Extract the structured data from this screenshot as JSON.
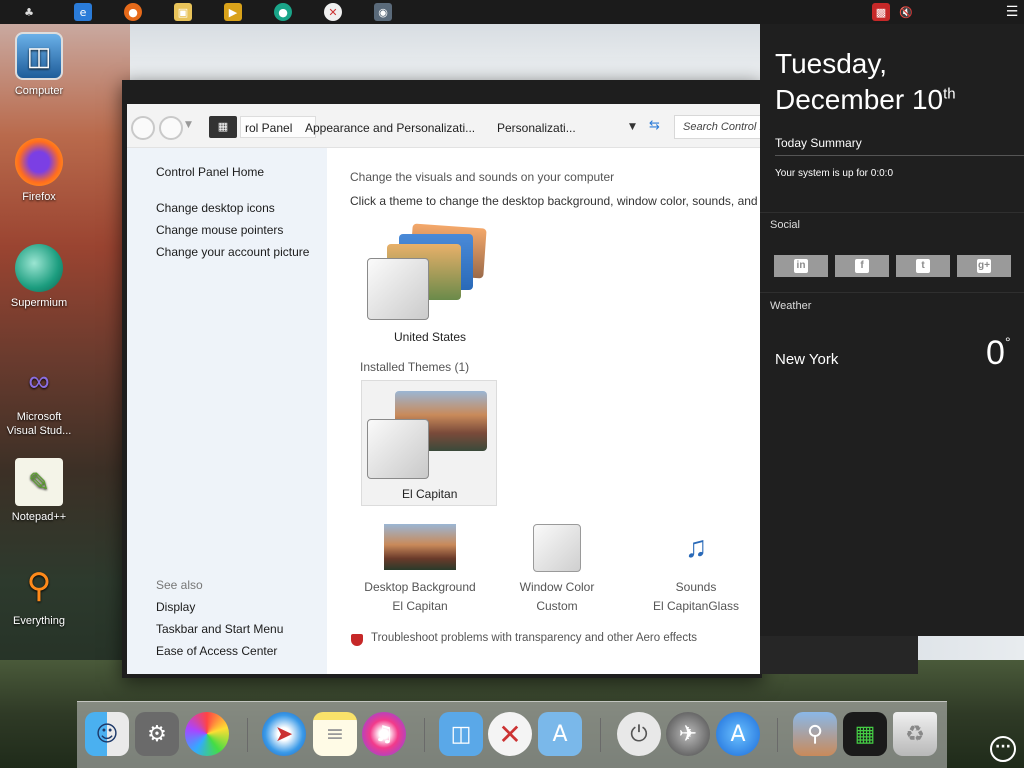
{
  "desktop": {
    "icons": [
      {
        "label": "Computer"
      },
      {
        "label": "Firefox"
      },
      {
        "label": "Supermium"
      },
      {
        "label": "Microsoft Visual Stud..."
      },
      {
        "label": "Notepad++"
      },
      {
        "label": "Everything"
      }
    ]
  },
  "window": {
    "breadcrumb": [
      "rol Panel",
      "Appearance and Personalizati...",
      "Personalizati..."
    ],
    "search_placeholder": "Search Control P",
    "left_nav": {
      "home": "Control Panel Home",
      "links": [
        "Change desktop icons",
        "Change mouse pointers",
        "Change your account picture"
      ],
      "see_also_label": "See also",
      "see_also": [
        "Display",
        "Taskbar and Start Menu",
        "Ease of Access Center"
      ]
    },
    "main": {
      "heading": "Change the visuals and sounds on your computer",
      "subheading": "Click a theme to change the desktop background, window color, sounds, and",
      "featured_theme": "United States",
      "installed_label": "Installed Themes (1)",
      "installed_theme": "El Capitan",
      "settings": [
        {
          "title": "Desktop Background",
          "value": "El Capitan"
        },
        {
          "title": "Window Color",
          "value": "Custom"
        },
        {
          "title": "Sounds",
          "value": "El CapitanGlass"
        }
      ],
      "troubleshoot": "Troubleshoot problems with transparency and other Aero effects"
    }
  },
  "side_panel": {
    "day": "Tuesday,",
    "date": "December 10",
    "date_suffix": "th",
    "summary_title": "Today Summary",
    "uptime": "Your system is up for 0:0:0",
    "social_label": "Social",
    "social_buttons": [
      "in",
      "f",
      "t",
      "g+"
    ],
    "weather_label": "Weather",
    "city": "New York",
    "temperature": "0",
    "degree": "°"
  },
  "colors": {
    "panel_bg": "#1f1f1f",
    "left_pane_bg": "#eef3f9",
    "social_button": "#9a9a9a"
  }
}
